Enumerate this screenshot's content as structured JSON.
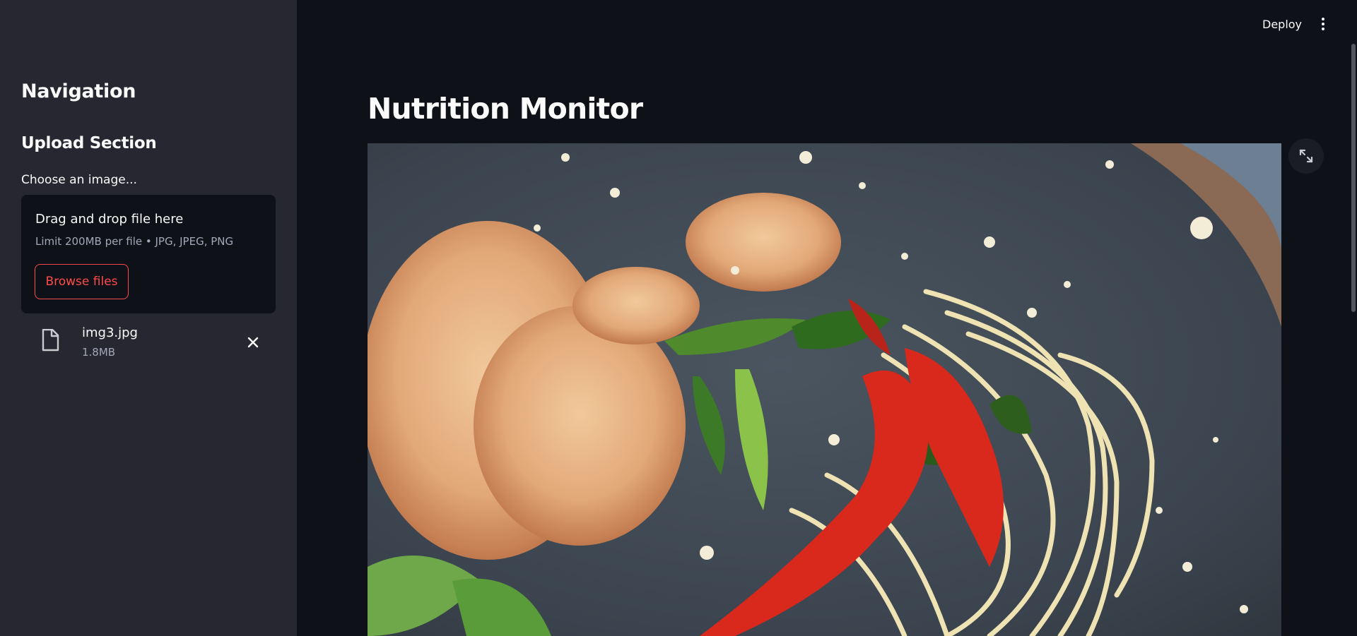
{
  "sidebar": {
    "title": "Navigation",
    "subtitle": "Upload Section",
    "uploader": {
      "label": "Choose an image...",
      "drop_title": "Drag and drop file here",
      "limits": "Limit 200MB per file • JPG, JPEG, PNG",
      "browse_label": "Browse files"
    },
    "file": {
      "name": "img3.jpg",
      "size": "1.8MB",
      "icon": "file-icon",
      "remove_icon": "close-icon"
    }
  },
  "header": {
    "deploy_label": "Deploy",
    "menu_icon": "more-vertical-icon"
  },
  "main": {
    "title": "Nutrition Monitor",
    "image_alt": "img3.jpg",
    "fullscreen_icon": "fullscreen-icon"
  },
  "colors": {
    "app_background": "#0e1117",
    "sidebar_background": "#262730",
    "accent": "#ff4b4b",
    "text": "#fafafa",
    "muted_text": "#a3a8b8"
  }
}
